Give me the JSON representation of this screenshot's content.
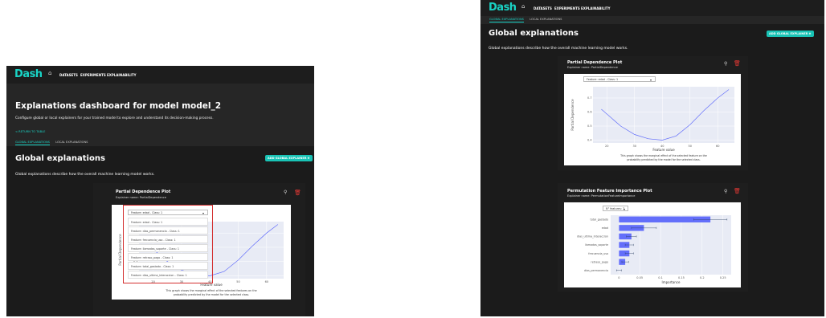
{
  "brand": "Dash",
  "nav": [
    "DATASETS",
    "EXPERIMENTS",
    "EXPLAINABILITY"
  ],
  "tabs": [
    "GLOBAL EXPLANATIONS",
    "LOCAL EXPLANATIONS"
  ],
  "left": {
    "page_title": "Explanations dashboard for model model_2",
    "page_sub": "Configure global or local explainers for your trained model to explore and understand its decision-making process.",
    "return_link": "< RETURN TO TABLE",
    "section_title": "Global explanations",
    "section_sub": "Global explanations describe how the overall machine learning model works.",
    "add_button": "ADD GLOBAL EXPLAINER",
    "card_title": "Partial Dependence Plot",
    "card_sub": "Explainer name: PartialDependence",
    "dropdown_value": "Feature: edad - Class: 1",
    "dropdown_options": [
      "Feature: edad - Class: 1",
      "Feature: dias_permanencia - Class: 1",
      "Feature: frecuencia_uso - Class: 1",
      "Feature: llamadas_soporte - Class: 1",
      "Feature: retraso_pago - Class: 1",
      "Feature: total_gastado - Class: 1",
      "Feature: dias_ultima_interaccion - Class: 1"
    ],
    "y_label": "Partial Dependence",
    "y_ticks": [
      "0.4",
      "0.5",
      "0.6",
      "0.7"
    ],
    "x_ticks": [
      "20",
      "30",
      "40",
      "50",
      "60"
    ],
    "x_label": "Feature value",
    "caption_1": "This graph shows the marginal effect of the selected features on the",
    "caption_2": "probability predicted by the model for the selected class."
  },
  "right": {
    "section_title": "Global explanations",
    "section_sub": "Global explanations describe how the overall machine learning model works.",
    "add_button": "ADD GLOBAL EXPLAINER",
    "pdp": {
      "card_title": "Partial Dependence Plot",
      "card_sub": "Explainer name: PartialDependence",
      "dropdown_value": "Feature: edad - Class: 1",
      "y_label": "Partial Dependence",
      "y_ticks": [
        "0.4",
        "0.5",
        "0.6",
        "0.7"
      ],
      "x_ticks": [
        "20",
        "30",
        "40",
        "50",
        "60"
      ],
      "x_label": "Feature value",
      "caption_1": "This graph shows the marginal effect of the selected feature on the",
      "caption_2": "probability predicted by the model for the selected class."
    },
    "pfi": {
      "card_title": "Permutation Feature Importance Plot",
      "card_sub": "Explainer name: PermutationFeatureImportance",
      "dropdown_value": "N° features: 7",
      "x_label": "Importance",
      "x_ticks": [
        "0",
        "0.05",
        "0.1",
        "0.15",
        "0.2",
        "0.25"
      ]
    }
  },
  "chart_data": [
    {
      "type": "line",
      "title": "Partial Dependence Plot",
      "xlabel": "Feature value",
      "ylabel": "Partial Dependence",
      "x": [
        18,
        25,
        30,
        35,
        40,
        45,
        50,
        55,
        60,
        64
      ],
      "y": [
        0.62,
        0.5,
        0.44,
        0.41,
        0.4,
        0.43,
        0.51,
        0.61,
        0.7,
        0.76
      ],
      "xlim": [
        15,
        66
      ],
      "ylim": [
        0.38,
        0.78
      ],
      "grid": true
    },
    {
      "type": "bar",
      "title": "Permutation Feature Importance Plot",
      "xlabel": "Importance",
      "categories": [
        "total_gastado",
        "edad",
        "dias_ultima_interaccion",
        "llamadas_soporte",
        "frecuencia_uso",
        "retraso_pago",
        "dias_permanencia"
      ],
      "values": [
        0.22,
        0.06,
        0.03,
        0.025,
        0.025,
        0.015,
        0.0
      ],
      "errors": [
        0.04,
        0.03,
        0.012,
        0.01,
        0.01,
        0.008,
        0.006
      ],
      "xlim": [
        -0.02,
        0.27
      ],
      "grid": true
    }
  ],
  "colors": {
    "accent": "#19d3c5",
    "line": "#636efa",
    "bar": "#636efa",
    "highlight": "#d32f2f",
    "delete": "#e53935"
  },
  "icons": [
    "home-icon",
    "add-circle-icon",
    "zoom-icon",
    "trash-icon",
    "chevron-down-icon"
  ]
}
